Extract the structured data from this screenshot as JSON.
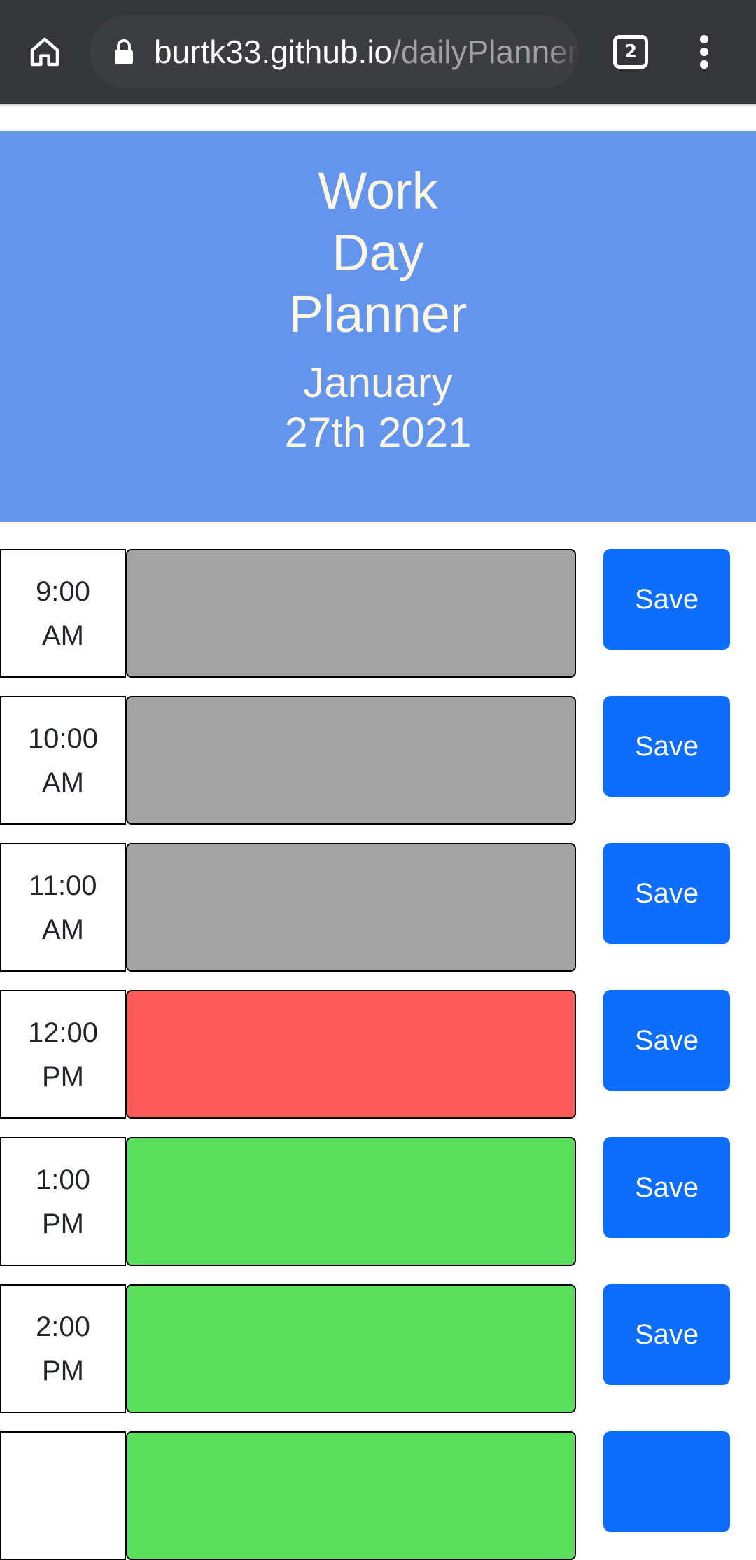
{
  "browser": {
    "url_host": "burtk33.github.io",
    "url_path": "/dailyPlanner",
    "tab_count": "2",
    "toolbar_color": "#35363a"
  },
  "header": {
    "title_lines": [
      "Work",
      "Day",
      "Planner"
    ],
    "date_lines": [
      "January",
      "27th 2021"
    ],
    "background": "#6495ed",
    "text_color": "#fdf6e3"
  },
  "time_blocks": [
    {
      "hour_line1": "9:00",
      "hour_line2": "AM",
      "status": "past",
      "text": "",
      "save_label": "Save"
    },
    {
      "hour_line1": "10:00",
      "hour_line2": "AM",
      "status": "past",
      "text": "",
      "save_label": "Save"
    },
    {
      "hour_line1": "11:00",
      "hour_line2": "AM",
      "status": "past",
      "text": "",
      "save_label": "Save"
    },
    {
      "hour_line1": "12:00",
      "hour_line2": "PM",
      "status": "present",
      "text": "",
      "save_label": "Save"
    },
    {
      "hour_line1": "1:00",
      "hour_line2": "PM",
      "status": "future",
      "text": "",
      "save_label": "Save"
    },
    {
      "hour_line1": "2:00",
      "hour_line2": "PM",
      "status": "future",
      "text": "",
      "save_label": "Save"
    }
  ],
  "status_colors": {
    "past": "#a3a3a3",
    "present": "#ff5a5a",
    "future": "#5ae05d",
    "save_button": "#0d6efd"
  }
}
